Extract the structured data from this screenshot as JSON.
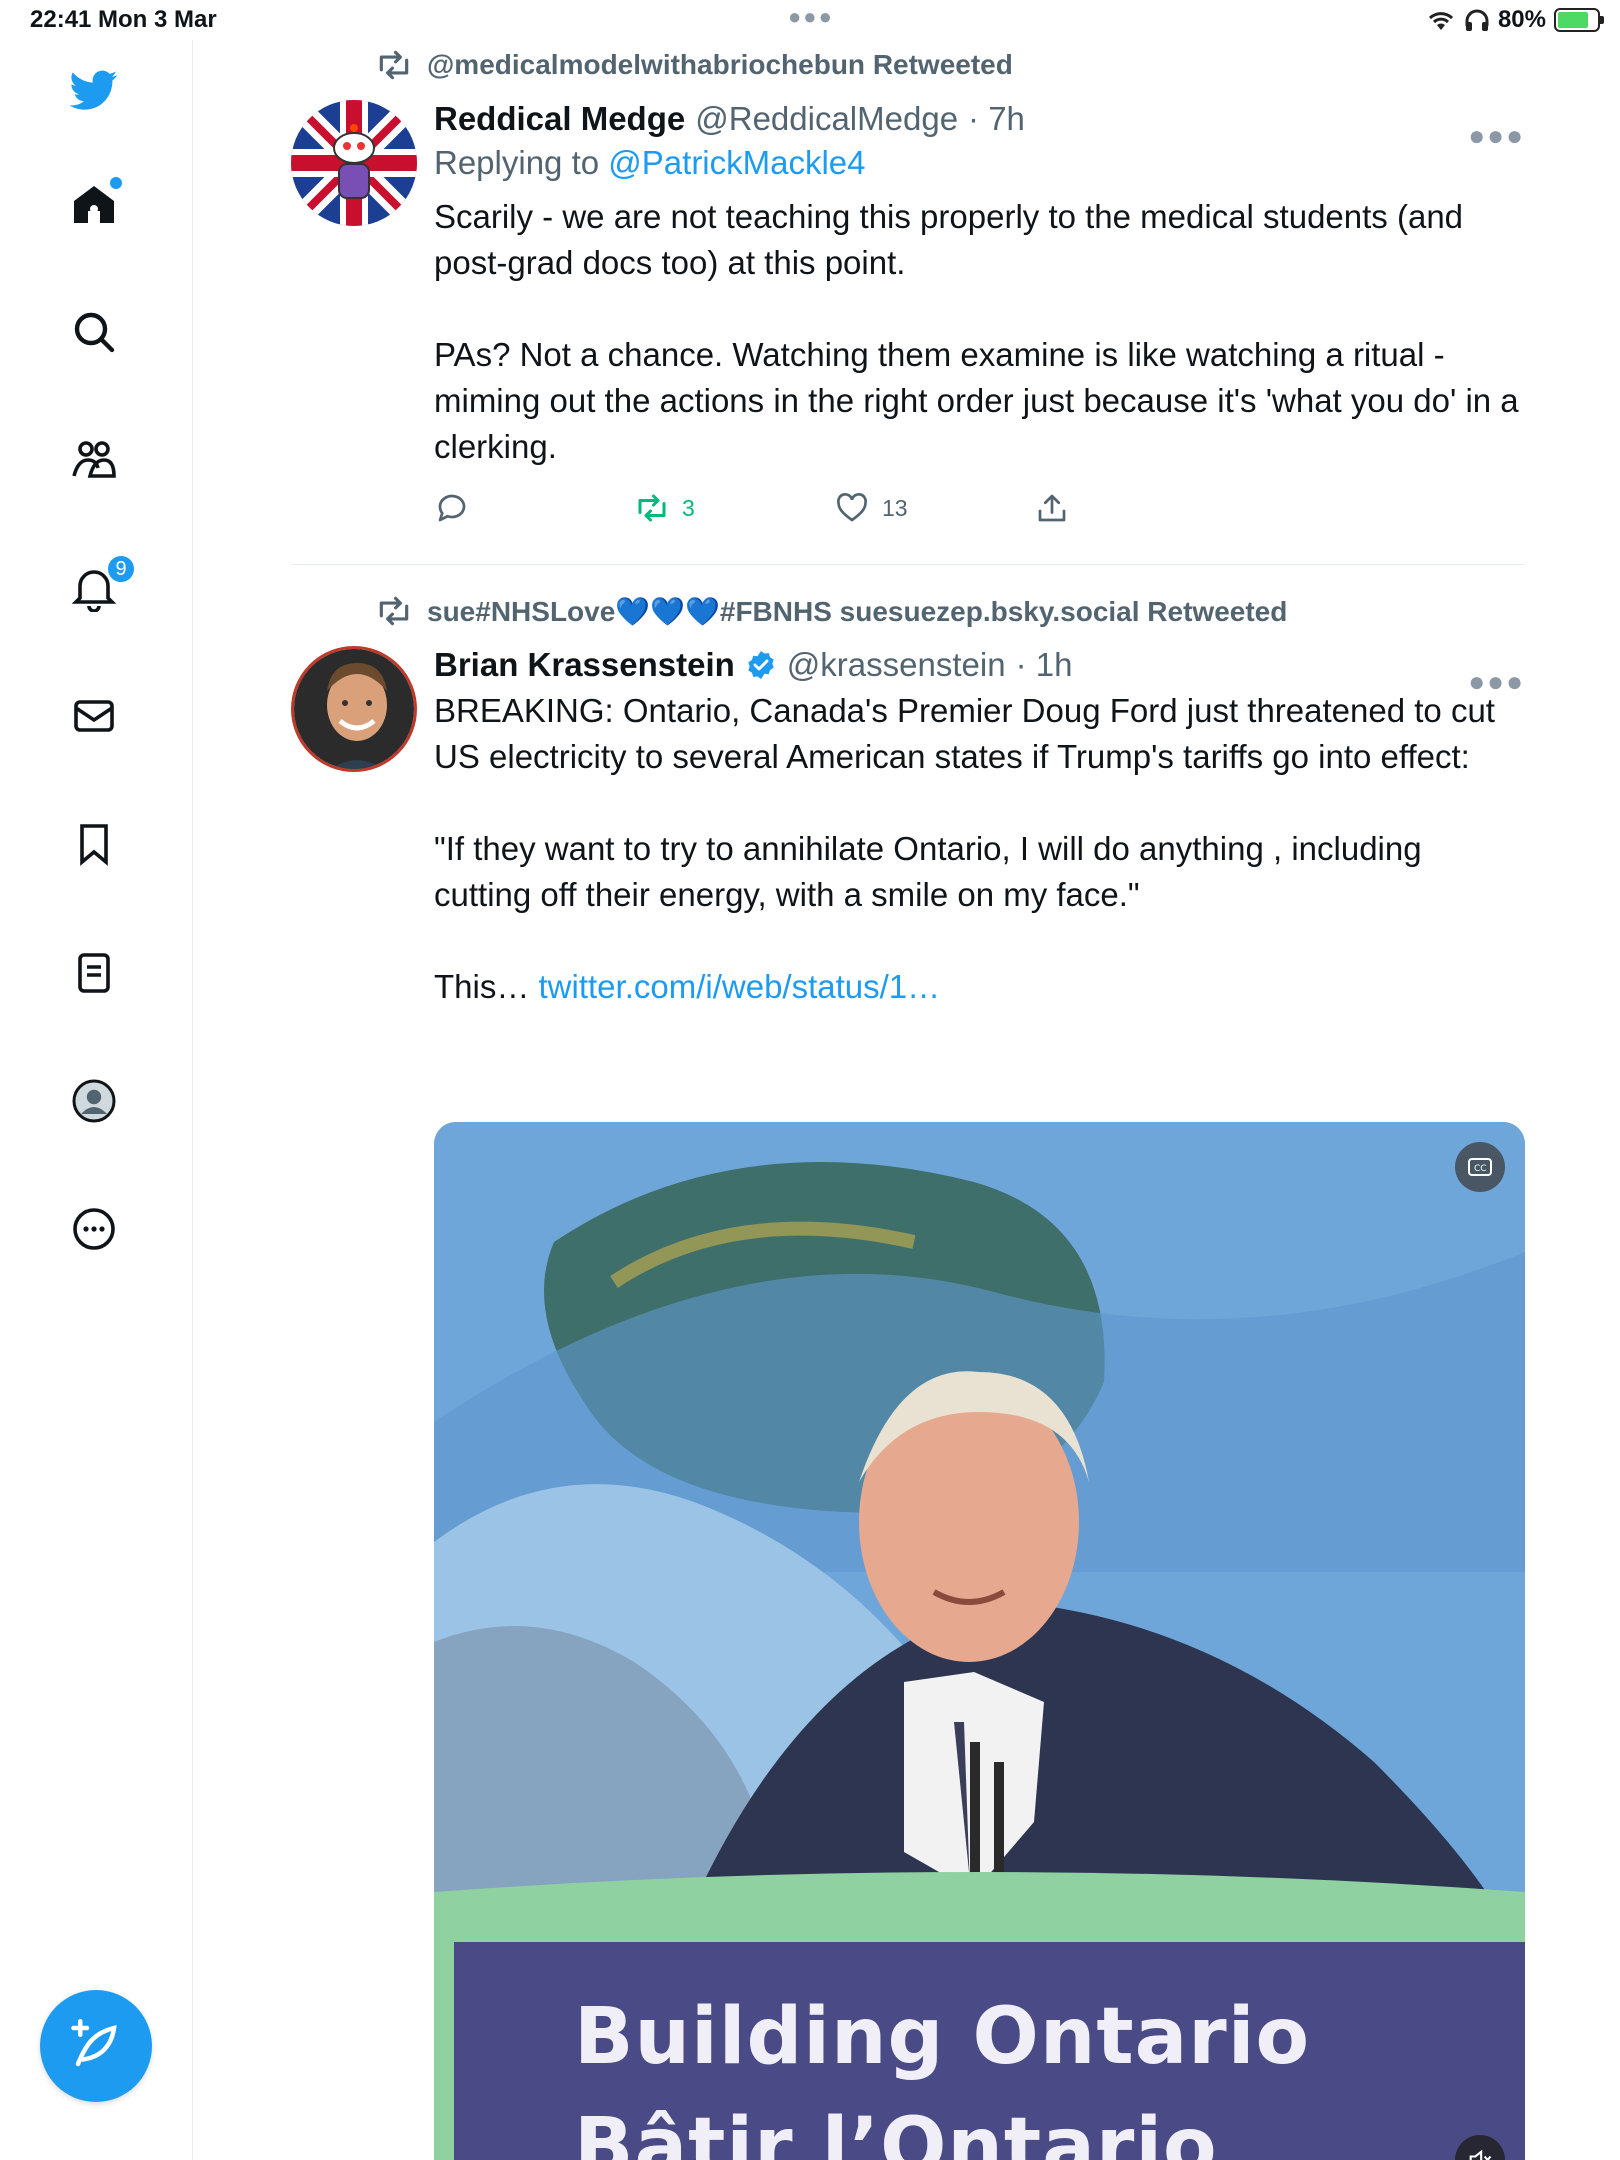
{
  "status_bar": {
    "time": "22:41",
    "date": "Mon 3 Mar",
    "battery": "80%"
  },
  "sidebar": {
    "notification_badge": "9"
  },
  "tweets": [
    {
      "retweeted_by": "@medicalmodelwithabriochebun Retweeted",
      "name": "Reddical Medge",
      "handle": "@ReddicalMedge",
      "time": "· 7h",
      "replying_label": "Replying to",
      "replying_to": "@PatrickMackle4",
      "body": "Scarily - we are not teaching this properly to the medical students (and post-grad docs too) at this point.\n\nPAs? Not a chance. Watching them examine is like watching a ritual - miming out the actions in the right order just because it's 'what you do' in a clerking.",
      "retweets": "3",
      "likes": "13"
    },
    {
      "retweeted_by": "sue#NHSLove💙💙💙#FBNHS suesuezep.bsky.social Retweeted",
      "name": "Brian Krassenstein",
      "handle": "@krassenstein",
      "time": "· 1h",
      "body": "BREAKING: Ontario, Canada's Premier Doug Ford just threatened to cut US electricity to several American states if Trump's tariffs go into effect:\n\n\"If they want to try to annihilate Ontario, I will do anything , including cutting off their energy, with a smile on my face.\"\n\nThis…",
      "link": "twitter.com/i/web/status/1…",
      "media": {
        "banner_line1": "Building Ontario",
        "banner_line2": "Bâtir l’Ontario"
      }
    }
  ],
  "colors": {
    "accent": "#1d9bf0",
    "retweet_green": "#00ba7c",
    "muted": "#536471"
  }
}
